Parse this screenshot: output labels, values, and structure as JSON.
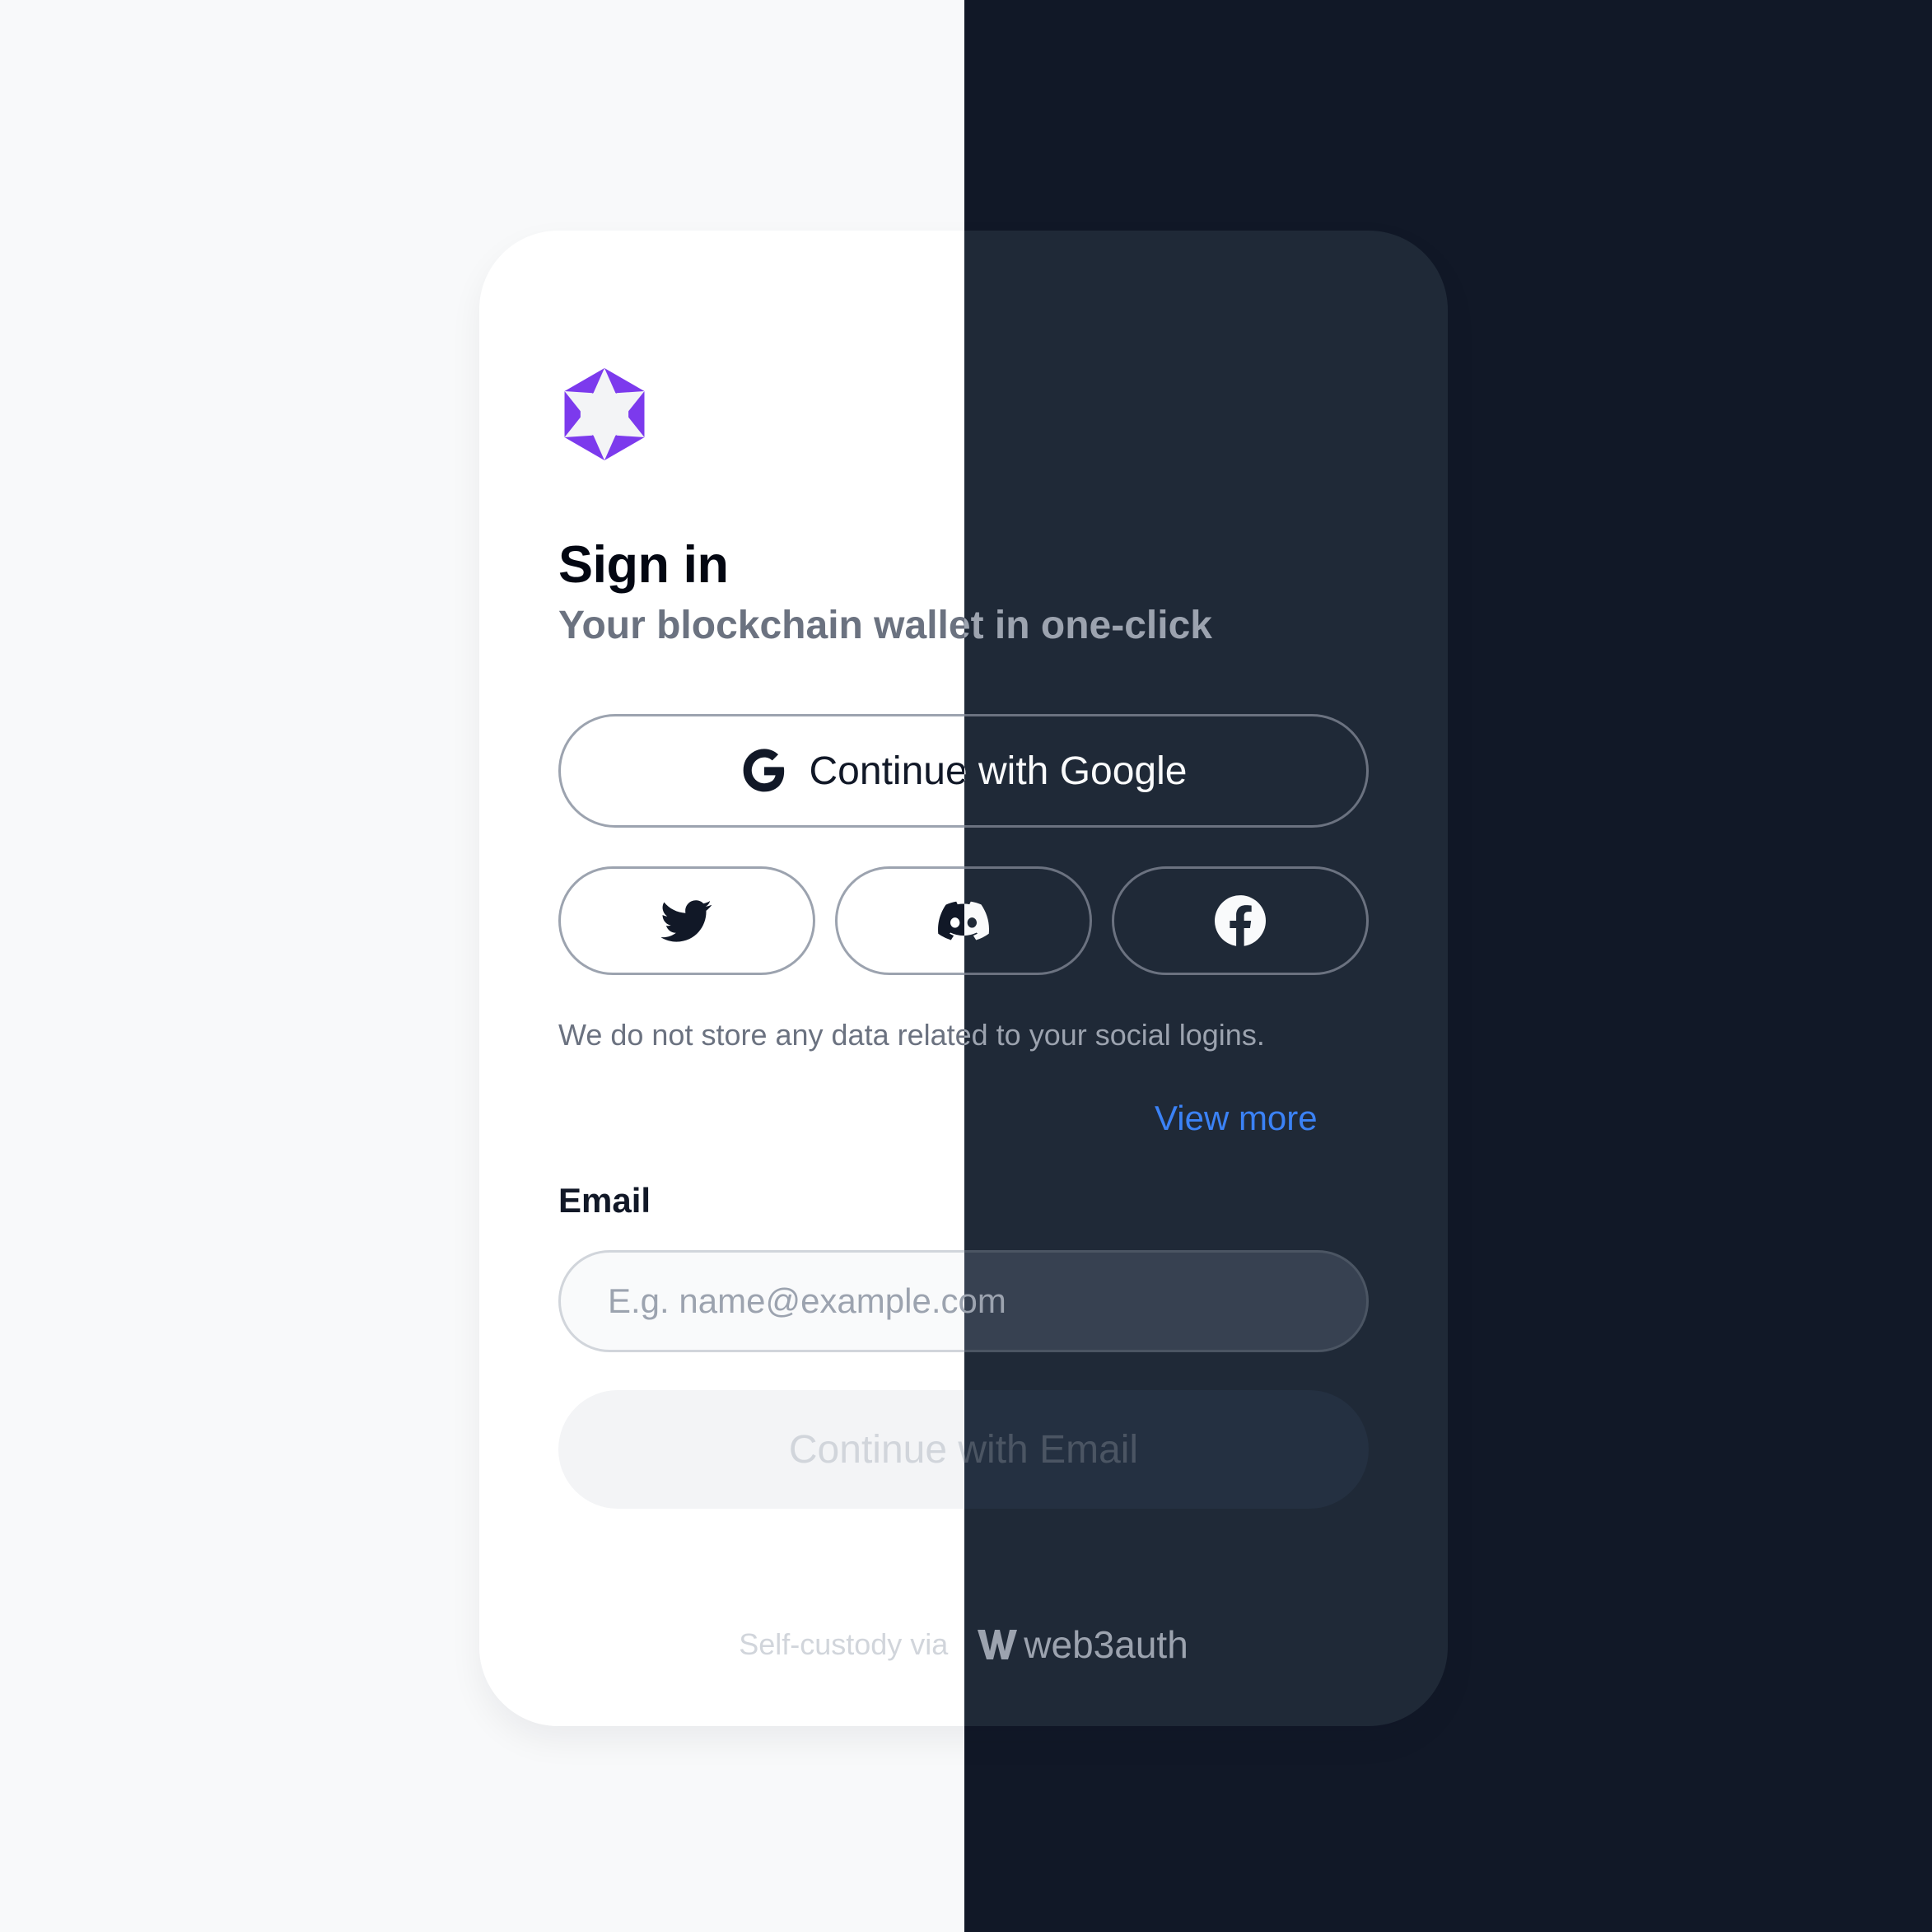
{
  "app": {
    "title": "Sign in",
    "subtitle": "Your blockchain wallet in one-click",
    "logo_icon": "purple-hexagram-icon",
    "brand_color": "#7c3aed"
  },
  "social": {
    "google_label": "Continue with Google",
    "google_icon": "google-icon",
    "providers": [
      {
        "name": "twitter",
        "icon": "twitter-icon"
      },
      {
        "name": "discord",
        "icon": "discord-icon"
      },
      {
        "name": "facebook",
        "icon": "facebook-icon"
      }
    ],
    "disclaimer": "We do not store any data related to your social logins.",
    "view_more": "View more",
    "link_color": "#3b82f6"
  },
  "email": {
    "label": "Email",
    "placeholder": "E.g. name@example.com",
    "value": "",
    "submit_label": "Continue with Email"
  },
  "footer": {
    "text": "Self-custody via",
    "brand": "web3auth",
    "brand_icon": "web3auth-w-icon"
  },
  "theme": {
    "light_background": "#f8f9fa",
    "dark_background": "#111827",
    "light_card": "#ffffff",
    "dark_card": "#1f2937"
  }
}
